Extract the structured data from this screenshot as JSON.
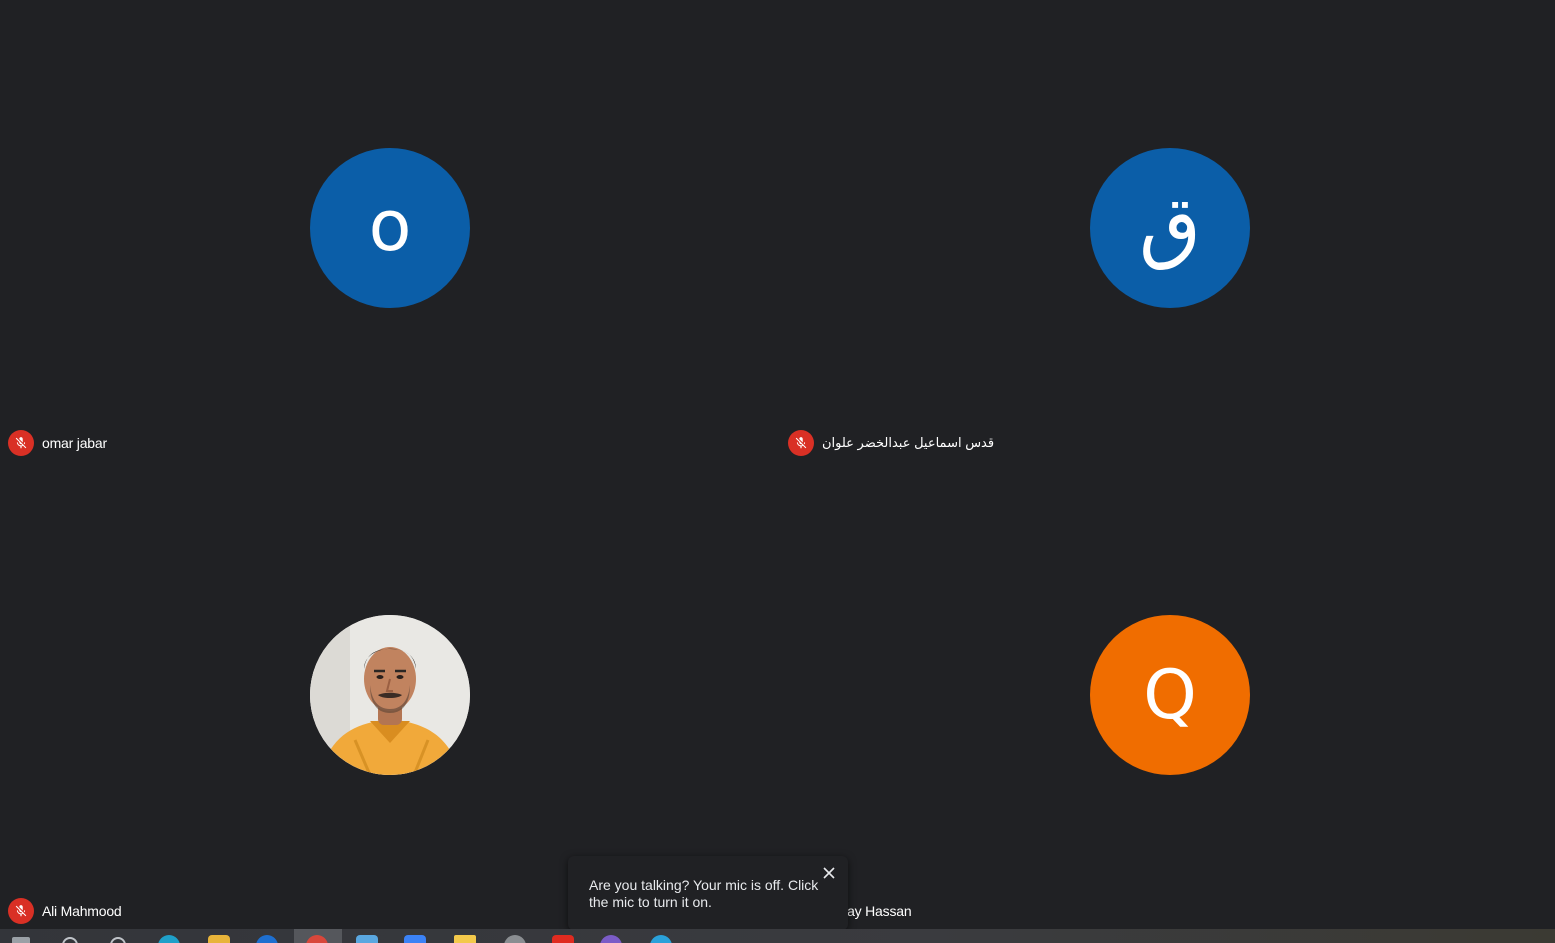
{
  "participants": [
    {
      "name": "omar jabar",
      "initial": "o",
      "avatar_color": "#0b5ea8",
      "muted": true
    },
    {
      "name": "قدس اسماعيل عبدالخضر علوان",
      "initial": "ق",
      "avatar_color": "#0b5ea8",
      "muted": true
    },
    {
      "name": "Ali Mahmood",
      "initial": "",
      "avatar_type": "photo",
      "muted": true
    },
    {
      "name": "Qusay Hassan",
      "initial": "Q",
      "avatar_color": "#f06d00",
      "muted": true
    }
  ],
  "toast": {
    "message": "Are you talking? Your mic is off. Click the mic to turn it on.",
    "close_icon": "close-icon"
  },
  "icons": {
    "muted_mic": "mic-off-icon"
  },
  "colors": {
    "background": "#202124",
    "muted_badge": "#d93025"
  },
  "taskbar": {
    "items": [
      "start-icon",
      "search-icon",
      "task-view-icon",
      "edge-icon",
      "file-explorer-icon",
      "store-icon",
      "chrome-icon",
      "app-icon",
      "meet-icon",
      "folder-icon",
      "settings-icon",
      "youtube-icon",
      "viber-icon",
      "telegram-icon"
    ]
  }
}
